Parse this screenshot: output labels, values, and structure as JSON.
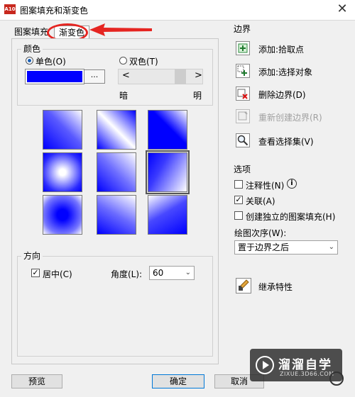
{
  "window": {
    "app_icon_text": "A10",
    "title": "图案填充和渐变色",
    "close_glyph": "✕"
  },
  "tabs": [
    {
      "label": "图案填充",
      "active": false
    },
    {
      "label": "渐变色",
      "active": true
    }
  ],
  "color_group": {
    "legend": "颜色",
    "single_color": {
      "label": "单色(O)",
      "selected": true
    },
    "two_color": {
      "label": "双色(T)",
      "selected": false
    },
    "swatch_color": "#0000ff",
    "swatch_button": "...",
    "slider": {
      "left_arrow": "<",
      "right_arrow": ">",
      "dark_label": "暗",
      "light_label": "明",
      "level": 0.92
    }
  },
  "gradient_patterns": [
    {
      "name": "linear-dark-bottom-left",
      "selected": false
    },
    {
      "name": "linear-diagonal-band",
      "selected": false
    },
    {
      "name": "linear-dark-top-left",
      "selected": false
    },
    {
      "name": "spherical",
      "selected": false
    },
    {
      "name": "hemispherical",
      "selected": false
    },
    {
      "name": "curved",
      "selected": true
    },
    {
      "name": "spherical-inverse",
      "selected": false
    },
    {
      "name": "linear-light-top-right",
      "selected": false
    },
    {
      "name": "linear-light-top-left",
      "selected": false
    }
  ],
  "orientation_group": {
    "legend": "方向",
    "centered": {
      "label": "居中(C)",
      "checked": true
    },
    "angle_label": "角度(L):",
    "angle_value": "60"
  },
  "boundaries": {
    "legend": "边界",
    "buttons": [
      {
        "label": "添加:拾取点",
        "icon": "add-pick-points-icon",
        "enabled": true
      },
      {
        "label": "添加:选择对象",
        "icon": "add-select-objects-icon",
        "enabled": true
      },
      {
        "label": "删除边界(D)",
        "icon": "remove-boundaries-icon",
        "enabled": true
      },
      {
        "label": "重新创建边界(R)",
        "icon": "recreate-boundary-icon",
        "enabled": false
      },
      {
        "label": "查看选择集(V)",
        "icon": "magnifier-icon",
        "enabled": true
      }
    ]
  },
  "options": {
    "legend": "选项",
    "annotative": {
      "label": "注释性(N)",
      "checked": false,
      "info_glyph": "i"
    },
    "associative": {
      "label": "关联(A)",
      "checked": true
    },
    "separate": {
      "label": "创建独立的图案填充(H)",
      "checked": false
    },
    "draw_order_label": "绘图次序(W):",
    "draw_order_value": "置于边界之后"
  },
  "inherit_properties": {
    "label": "继承特性",
    "icon": "inherit-brush-icon"
  },
  "footer": {
    "preview": "预览",
    "ok": "确定",
    "cancel": "取消"
  },
  "watermark": {
    "title": "溜溜自学",
    "url": "ZIXUE.3D66.COM"
  },
  "colors": {
    "accent_red": "#e52521",
    "gradient_blue": "#0000ff"
  }
}
